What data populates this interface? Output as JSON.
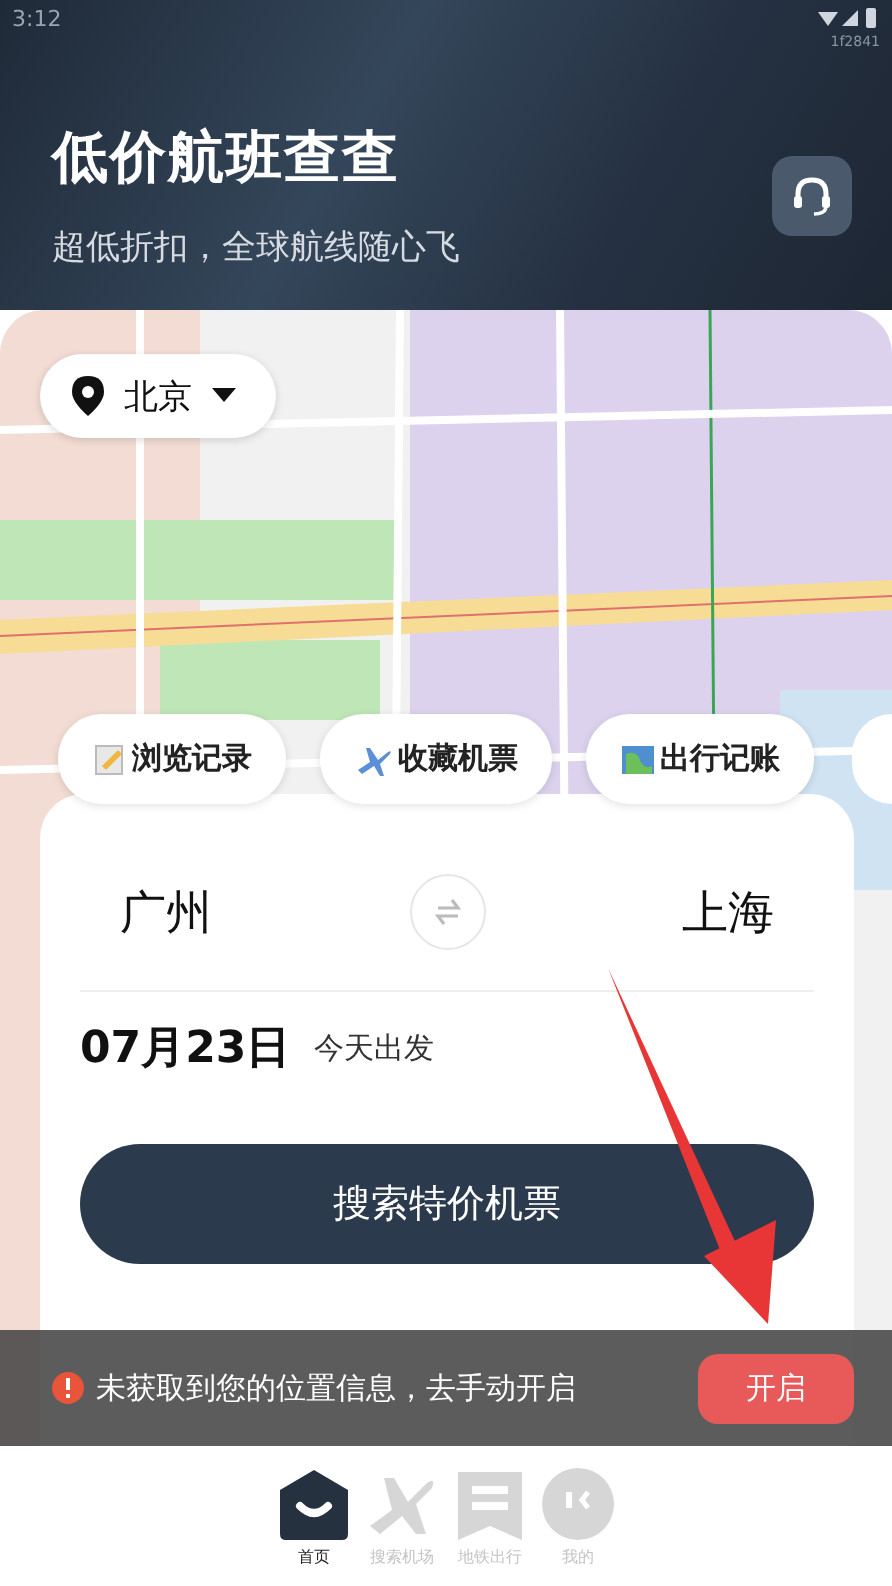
{
  "status_bar": {
    "time": "3:12",
    "build": "1f2841"
  },
  "header": {
    "title": "低价航班查查",
    "subtitle": "超低折扣，全球航线随心飞"
  },
  "location": {
    "city": "北京"
  },
  "shortcuts": [
    {
      "label": "浏览记录",
      "kind": "memo"
    },
    {
      "label": "收藏机票",
      "kind": "plane"
    },
    {
      "label": "出行记账",
      "kind": "map"
    }
  ],
  "search": {
    "from": "广州",
    "to": "上海",
    "date": "07月23日",
    "date_note": "今天出发",
    "button": "搜索特价机票"
  },
  "notice": {
    "text": "未获取到您的位置信息，去手动开启",
    "button": "开启"
  },
  "tabs": [
    {
      "label": "首页",
      "kind": "home",
      "selected": true
    },
    {
      "label": "搜索机场",
      "kind": "plane",
      "selected": false
    },
    {
      "label": "地铁出行",
      "kind": "metro",
      "selected": false
    },
    {
      "label": "我的",
      "kind": "face",
      "selected": false
    }
  ]
}
